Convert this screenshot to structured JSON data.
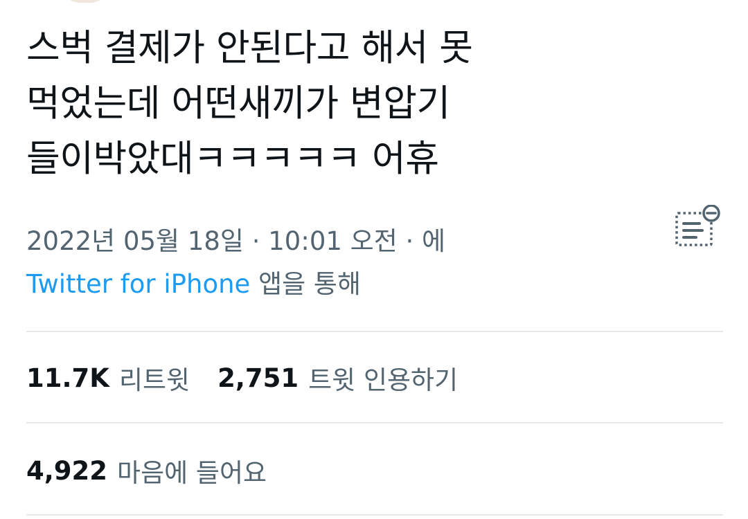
{
  "tweet": {
    "text": "스벅 결제가 안된다고 해서 못\n먹었는데 어떤새끼가 변압기\n들이박았대ㅋㅋㅋㅋㅋ 어휴",
    "date": "2022년 05월 18일",
    "separator": "·",
    "time": "10:01 오전",
    "via_prefix": "에",
    "source": "Twitter for iPhone",
    "via_suffix": "앱을 통해"
  },
  "stats": {
    "retweets_count": "11.7K",
    "retweets_label": "리트윗",
    "quotes_count": "2,751",
    "quotes_label": "트윗 인용하기",
    "likes_count": "4,922",
    "likes_label": "마음에 들어요"
  },
  "icons": {
    "translate": "translate-icon"
  },
  "colors": {
    "text": "#0f1419",
    "secondary": "#536471",
    "link": "#1d9bf0",
    "divider": "#e6e9ec"
  }
}
